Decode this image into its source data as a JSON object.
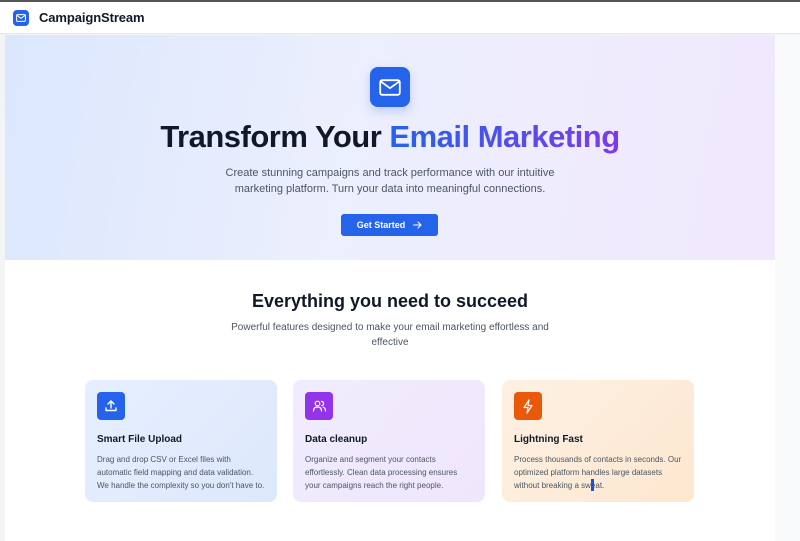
{
  "header": {
    "brand": "CampaignStream",
    "logo_icon": "mail-icon"
  },
  "hero": {
    "icon": "mail-icon",
    "title_plain": "Transform Your ",
    "title_highlight": "Email Marketing",
    "subtitle": "Create stunning campaigns and track performance with our intuitive marketing platform. Turn your data into meaningful connections.",
    "cta_label": "Get Started",
    "cta_icon": "arrow-right-icon"
  },
  "features": {
    "title": "Everything you need to succeed",
    "subtitle": "Powerful features designed to make your email marketing effortless and effective",
    "cards": [
      {
        "icon": "upload-icon",
        "icon_color": "#2563eb",
        "title": "Smart File Upload",
        "text": "Drag and drop CSV or Excel files with automatic field mapping and data validation. We handle the complexity so you don't have to."
      },
      {
        "icon": "users-icon",
        "icon_color": "#9333ea",
        "title": "Data cleanup",
        "text": "Organize and segment your contacts effortlessly. Clean data processing ensures your campaigns reach the right people."
      },
      {
        "icon": "lightning-icon",
        "icon_color": "#ea580c",
        "title": "Lightning Fast",
        "text": "Process thousands of contacts in seconds. Our optimized platform handles large datasets without breaking a sweat."
      }
    ]
  },
  "colors": {
    "primary": "#2563eb",
    "accent_purple": "#7c3aed",
    "accent_orange": "#ea580c"
  }
}
